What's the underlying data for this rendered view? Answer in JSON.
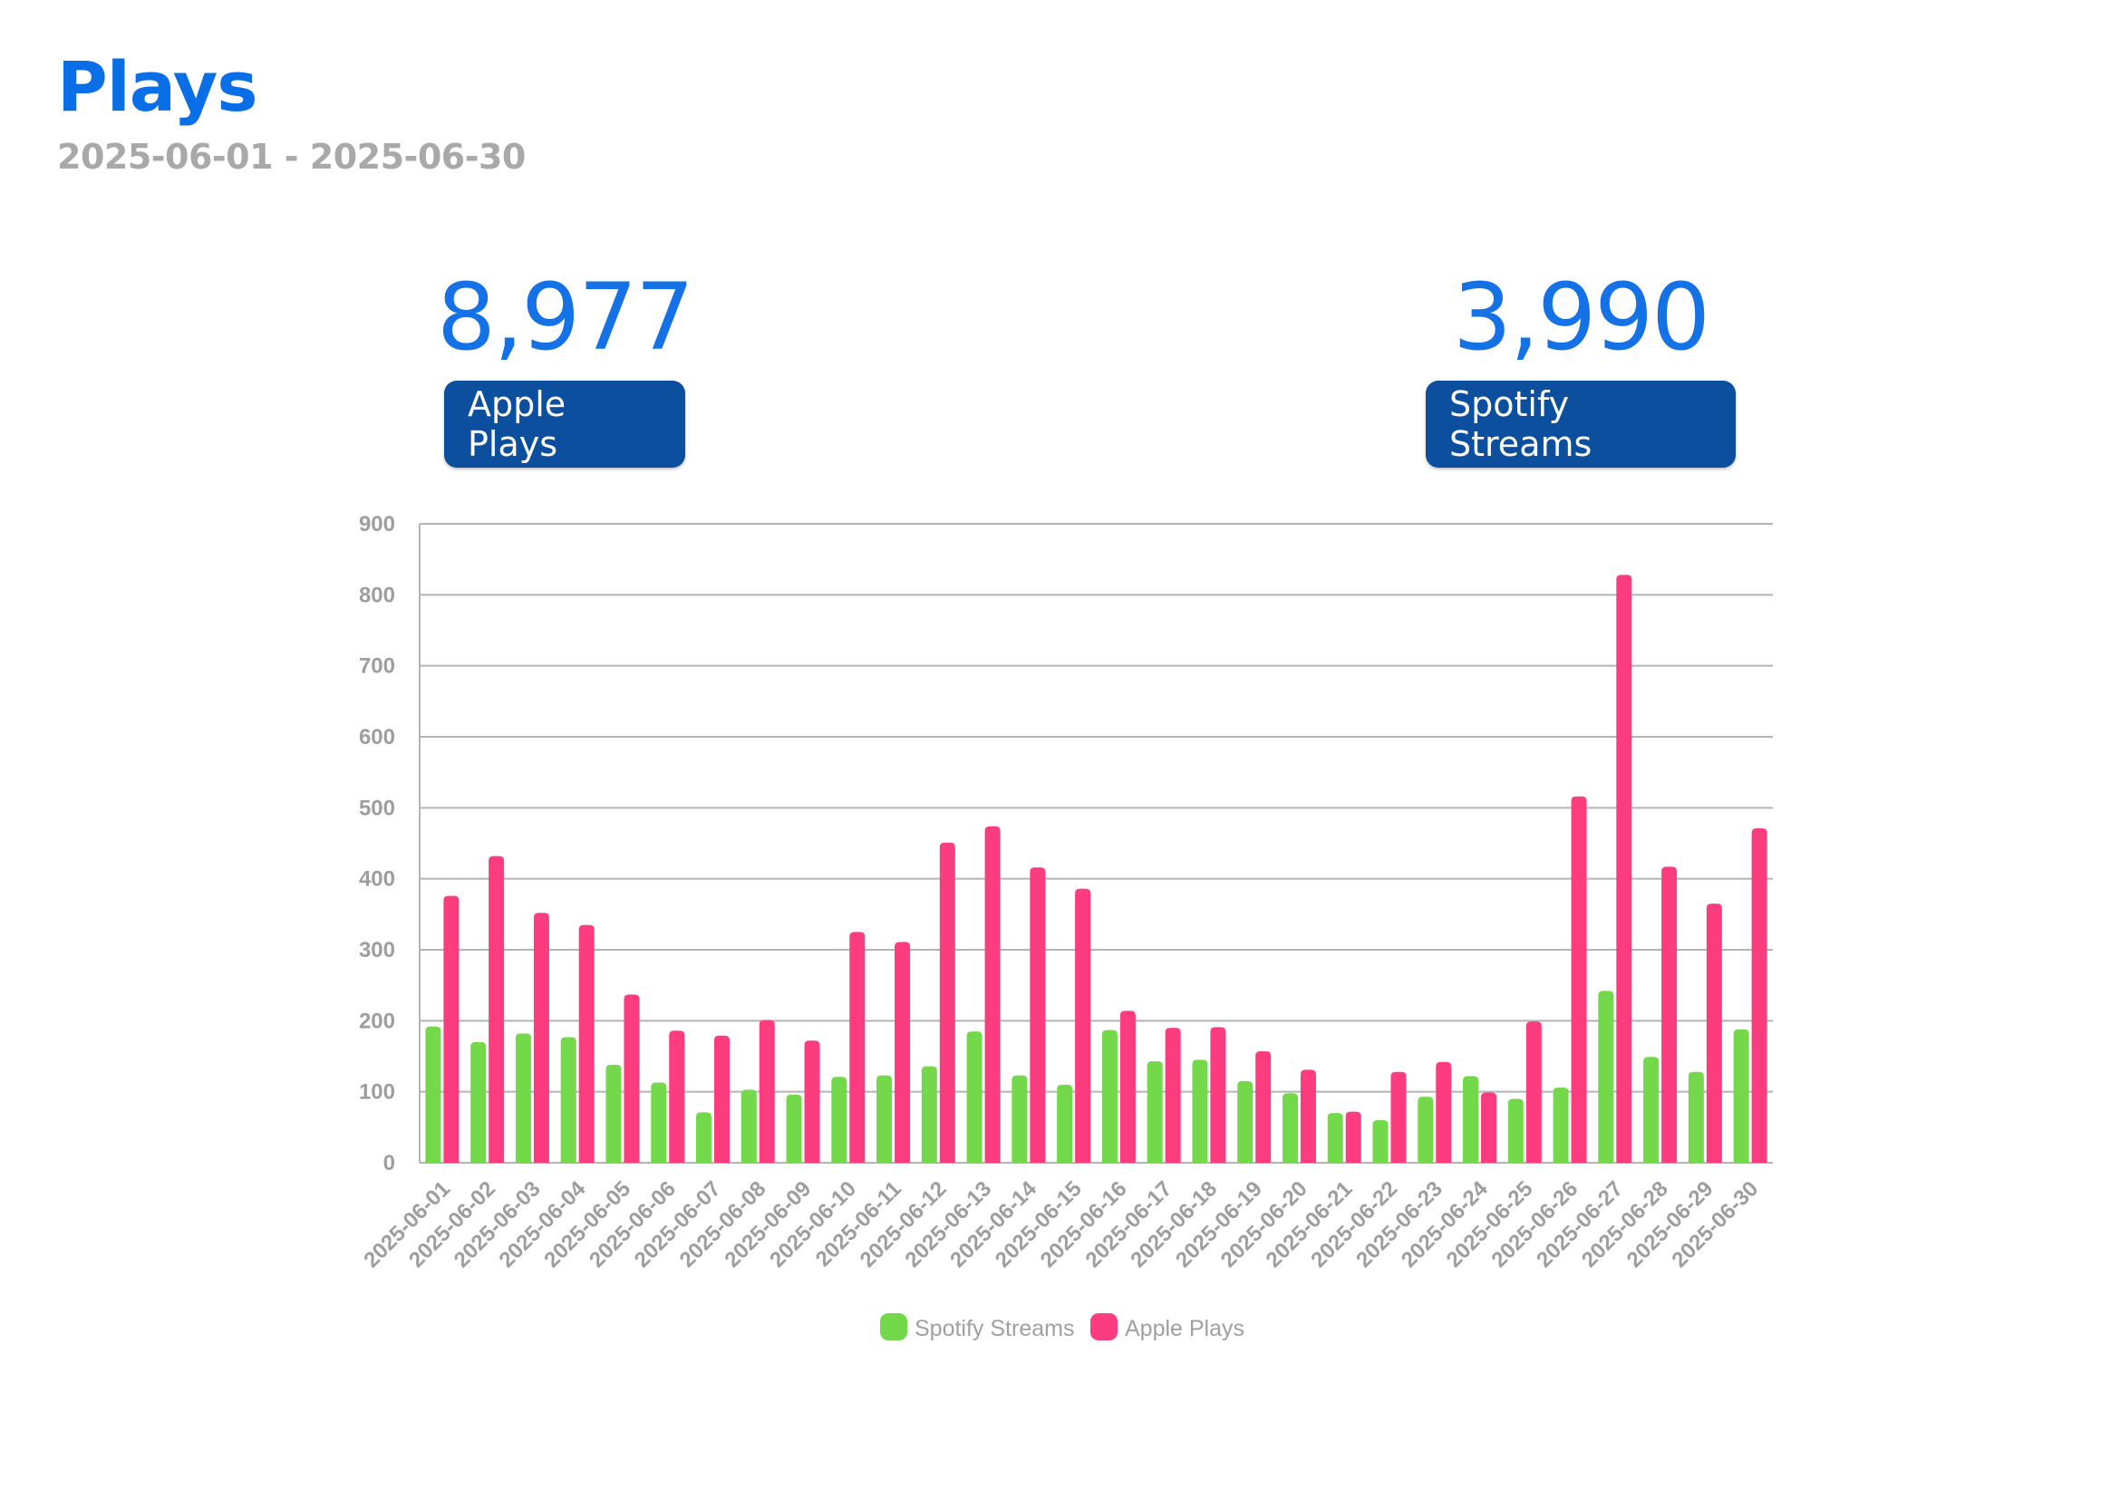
{
  "header": {
    "title": "Plays",
    "date_range": "2025-06-01 - 2025-06-30"
  },
  "kpis": {
    "apple": {
      "value": "8,977",
      "label": "Apple Plays"
    },
    "spotify": {
      "value": "3,990",
      "label": "Spotify Streams"
    }
  },
  "colors": {
    "title": "#0a6ee6",
    "kpi_value": "#1571e6",
    "kpi_label_bg": "#0c4f9e",
    "spotify": "#74d94a",
    "apple": "#fb3c7f",
    "grid": "#b4b4b4"
  },
  "chart_data": {
    "type": "bar",
    "categories": [
      "2025-06-01",
      "2025-06-02",
      "2025-06-03",
      "2025-06-04",
      "2025-06-05",
      "2025-06-06",
      "2025-06-07",
      "2025-06-08",
      "2025-06-09",
      "2025-06-10",
      "2025-06-11",
      "2025-06-12",
      "2025-06-13",
      "2025-06-14",
      "2025-06-15",
      "2025-06-16",
      "2025-06-17",
      "2025-06-18",
      "2025-06-19",
      "2025-06-20",
      "2025-06-21",
      "2025-06-22",
      "2025-06-23",
      "2025-06-24",
      "2025-06-25",
      "2025-06-26",
      "2025-06-27",
      "2025-06-28",
      "2025-06-29",
      "2025-06-30"
    ],
    "series": [
      {
        "name": "Spotify Streams",
        "values": [
          192,
          170,
          182,
          177,
          138,
          113,
          71,
          103,
          96,
          121,
          123,
          136,
          185,
          123,
          110,
          187,
          143,
          145,
          115,
          98,
          70,
          60,
          93,
          122,
          90,
          106,
          242,
          149,
          128,
          188
        ]
      },
      {
        "name": "Apple Plays",
        "values": [
          376,
          432,
          352,
          335,
          237,
          186,
          179,
          201,
          172,
          325,
          311,
          451,
          474,
          416,
          386,
          214,
          190,
          191,
          157,
          131,
          72,
          128,
          142,
          99,
          199,
          516,
          828,
          417,
          365,
          471
        ]
      }
    ],
    "yticks": [
      0,
      100,
      200,
      300,
      400,
      500,
      600,
      700,
      800,
      900
    ],
    "ylim": [
      0,
      900
    ],
    "grid": true,
    "legend": "bottom-center"
  }
}
